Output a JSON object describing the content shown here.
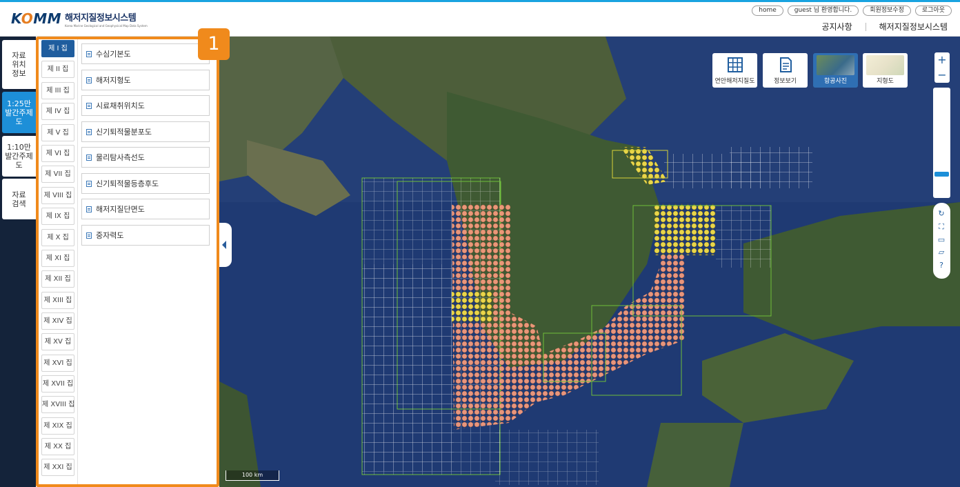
{
  "logo": {
    "mark": "KOMM",
    "title": "해저지질정보시스템",
    "subtitle": "Korea Marine Geological and Geophysical Map Data System"
  },
  "util_links": [
    "home",
    "guest 님 환영합니다.",
    "회원정보수정",
    "로그아웃"
  ],
  "gnb": [
    "공지사항",
    "해저지질정보시스템"
  ],
  "left_nav": [
    {
      "label": "자료\n위치\n정보",
      "active": false
    },
    {
      "label": "1:25만\n발간주제도",
      "active": true
    },
    {
      "label": "1:10만\n발간주제도",
      "active": false
    },
    {
      "label": "자료\n검색",
      "active": false
    }
  ],
  "sets": [
    "제 I 집",
    "제 II 집",
    "제 III 집",
    "제 IV 집",
    "제 V 집",
    "제 VI 집",
    "제 VII 집",
    "제 VIII 집",
    "제 IX 집",
    "제 X 집",
    "제 XI 집",
    "제 XII 집",
    "제 XIII 집",
    "제 XIV 집",
    "제 XV 집",
    "제 XVI 집",
    "제 XVII 집",
    "제 XVIII 집",
    "제 XIX 집",
    "제 XX 집",
    "제 XXI 집"
  ],
  "active_set": "제 I 집",
  "maps": [
    "수심기본도",
    "해저지형도",
    "시료채취위치도",
    "신기퇴적물분포도",
    "물리탐사측선도",
    "신기퇴적물등층후도",
    "해저지질단면도",
    "중자력도"
  ],
  "callout": "1",
  "map_tools": [
    {
      "label": "연안해저지질도",
      "icon": "grid-icon",
      "active": false
    },
    {
      "label": "정보보기",
      "icon": "document-icon",
      "active": false
    },
    {
      "label": "항공사진",
      "icon": "aerial-photo-thumbnail",
      "active": true
    },
    {
      "label": "지형도",
      "icon": "terrain-map-thumbnail",
      "active": false
    }
  ],
  "zoom": {
    "in": "+",
    "out": "−"
  },
  "scale_label": "100 km",
  "colors": {
    "accent": "#1d8fd8",
    "highlight": "#f08a1c",
    "nav_bg": "#14233a",
    "survey_fill": "#f0977a"
  }
}
